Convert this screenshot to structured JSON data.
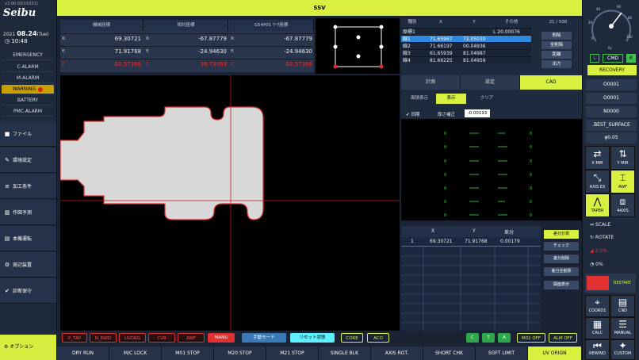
{
  "app": {
    "version": "v2.00.02(10331)",
    "logo": "Seibu",
    "year": "2021",
    "date": "08.24",
    "weekday": "(Tue)",
    "time": "10:48",
    "title": "SSV"
  },
  "alarms": [
    "EMERGENCY",
    "C-ALARM",
    "M-ALARM",
    "WARNING",
    "BATTERY",
    "PMC-ALARM"
  ],
  "menu": [
    {
      "label": "ファイル",
      "icon": "file-icon"
    },
    {
      "label": "環境設定",
      "icon": "settings-icon"
    },
    {
      "label": "加工条件",
      "icon": "condition-icon"
    },
    {
      "label": "作図予測",
      "icon": "chart-icon"
    },
    {
      "label": "本機運転",
      "icon": "machine-icon"
    },
    {
      "label": "周辺装置",
      "icon": "device-icon"
    },
    {
      "label": "診断保守",
      "icon": "check-icon"
    }
  ],
  "option_label": "オプション",
  "coords": {
    "headers": [
      "機械座標",
      "相対座標",
      "G54P01 ﾜｰｸ座標"
    ],
    "rows": [
      {
        "axis": "X:",
        "m": "69.30721",
        "r": "-67.87779",
        "w": "-67.87779"
      },
      {
        "axis": "Y:",
        "m": "71.91768",
        "r": "-24.94630",
        "w": "-24.94630"
      },
      {
        "axis": "Z:",
        "m": "62.57366",
        "r": "36.73063",
        "w": "62.57366"
      }
    ]
  },
  "points": {
    "headers": [
      "種別",
      "X",
      "Y",
      "その他"
    ],
    "page": "21 / 500",
    "rows": [
      {
        "t": "原標1",
        "x": "",
        "y": "",
        "o": "L 20.00076"
      },
      {
        "t": "線1",
        "x": "71.65967",
        "y": "72.05010",
        "o": ""
      },
      {
        "t": "線2",
        "x": "71.66197",
        "y": "00.04936",
        "o": ""
      },
      {
        "t": "線3",
        "x": "61.65939",
        "y": "81.04987",
        "o": ""
      },
      {
        "t": "線4",
        "x": "81.66225",
        "y": "81.04959",
        "o": ""
      }
    ],
    "buttons": [
      "削除",
      "全削除",
      "距離",
      "出力"
    ]
  },
  "tabs": [
    "計測",
    "設定",
    "CAD"
  ],
  "subtabs": [
    "面積表示",
    "表示",
    "クリア"
  ],
  "sync_label": "同期",
  "thick_label": "厚さ補正",
  "thick_value": "-0.00193",
  "diff": {
    "headers": [
      "X",
      "Y",
      "差分"
    ],
    "row": {
      "n": "1",
      "x": "69.30721",
      "y": "71.91768",
      "d": "0.00179"
    },
    "buttons": [
      "差分計測",
      "チェック",
      "差分削除",
      "差分全削除",
      "図面表示"
    ]
  },
  "toolbar": [
    "P_TAP",
    "N_RWD",
    "UVORG",
    "CVR",
    "AWF",
    "MANU",
    "手動モード",
    "リセット状態",
    "CORE",
    "ACO",
    "C",
    "T",
    "A",
    "M02 OFF",
    "ALM OFF"
  ],
  "bottom": [
    "DRY RUN",
    "M/C LOCK",
    "M01 STOP",
    "M20 STOP",
    "M21 STOP",
    "SINGLE BLK",
    "AXIS ROT.",
    "SHORT CHK",
    "SOFT LIMIT",
    "UV ORIGN"
  ],
  "right": {
    "gauge_labels": [
      "0",
      "20",
      "40",
      "60",
      "80",
      "100"
    ],
    "gauge_unit": "0v",
    "l": "L",
    "cmd": "CMD",
    "r": "R",
    "recovery": "RECOVERY",
    "info": [
      "O0001",
      "O0001",
      "N0000",
      ".BEST_SURFACE",
      "φ0.05"
    ],
    "icons": [
      "X MIR",
      "Y MIR",
      "AXIS EX",
      "AWF",
      "TAPER",
      "4AXIS"
    ],
    "scale": "SCALE",
    "rotate": "ROTATE",
    "angle": "2.0%",
    "pct": "0%",
    "restart": "RESTART",
    "func": [
      "COORD1",
      "CND",
      "CALC",
      "MANUAL",
      "REWIND",
      "CUSTOM"
    ]
  }
}
